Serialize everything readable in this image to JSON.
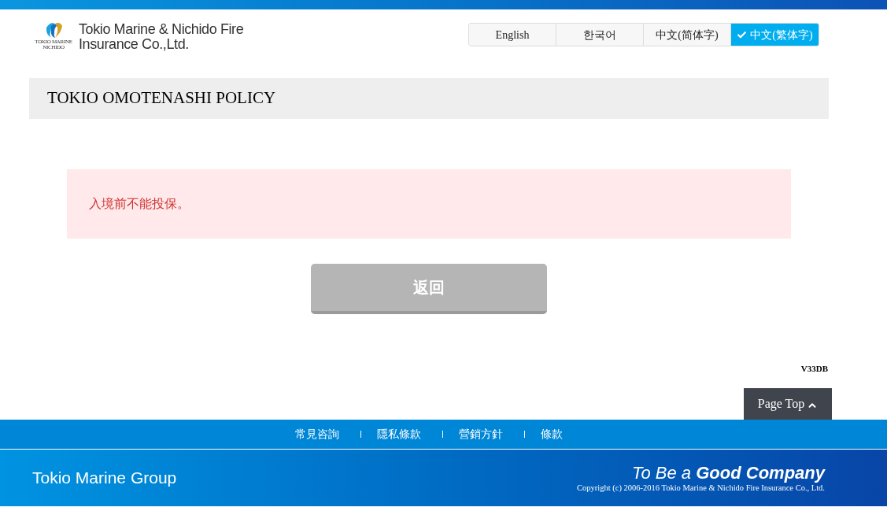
{
  "header": {
    "logo": {
      "emblem_caption": [
        "TOKIO MARINE",
        "NICHIDO"
      ],
      "name_lines": [
        "Tokio Marine & Nichido Fire",
        "Insurance Co.,Ltd."
      ]
    },
    "language_tabs": [
      {
        "label": "English",
        "selected": false
      },
      {
        "label": "한국어",
        "selected": false
      },
      {
        "label": "中文(简体字)",
        "selected": false
      },
      {
        "label": "中文(繁体字)",
        "selected": true
      }
    ]
  },
  "title": "TOKIO OMOTENASHI POLICY",
  "error_message": "入境前不能投保。",
  "back_button": "返回",
  "version": "V33DB",
  "page_top_button": "Page Top",
  "footer": {
    "links": [
      "常見咨詢",
      "隱私條款",
      "營銷方針",
      "條款"
    ],
    "group_name": "Tokio Marine Group",
    "slogan": "To Be a **Good Company**",
    "copyright": "Copyright (c) 2006-2016 Tokio Marine & Nichido Fire Insurance Co., Ltd."
  }
}
